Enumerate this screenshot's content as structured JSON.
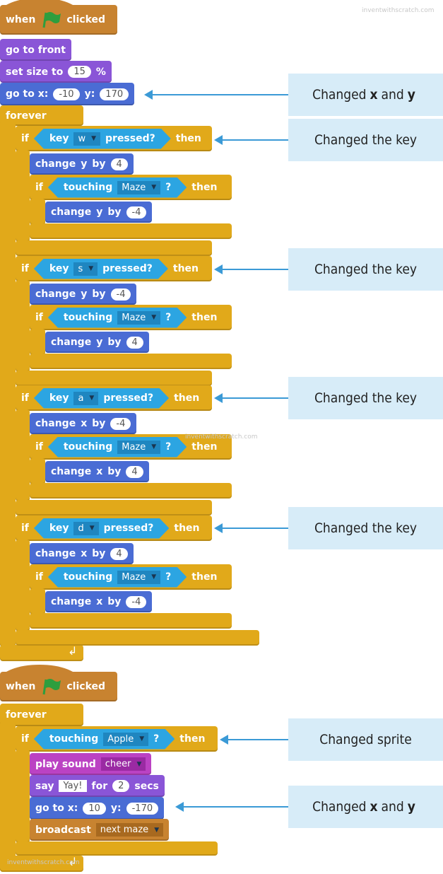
{
  "colors": {
    "events": "#c88330",
    "looks": "#8a55d7",
    "motion": "#4a6cd4",
    "control": "#e1a91a",
    "sensing": "#2ca5e2",
    "sensing_dropdown": "#1f86c0",
    "sound": "#bb42c3",
    "sound_dropdown": "#9a2aa3",
    "events_dropdown": "#a8691f",
    "callout": "#d7ecf8",
    "arrow": "#3b9ad6",
    "flag": "#2e9e3e"
  },
  "watermark": "inventwithscratch.com",
  "script1": {
    "hat": {
      "when": "when",
      "clicked": "clicked",
      "icon": "green-flag-icon"
    },
    "go_to_front": "go to front",
    "set_size": {
      "label": "set size to",
      "value": "15",
      "unit": "%"
    },
    "go_to": {
      "x_label": "go to x:",
      "x": "-10",
      "y_label": "y:",
      "y": "170"
    },
    "forever": "forever",
    "ifs": [
      {
        "if": "if",
        "key": "key",
        "key_value": "w",
        "pressed": "pressed?",
        "then": "then",
        "change1": {
          "label1": "change",
          "axis": "y",
          "by": "by",
          "value": "4"
        },
        "touching": {
          "label": "touching",
          "target": "Maze",
          "q": "?",
          "then": "then",
          "if": "if"
        },
        "change2": {
          "label1": "change",
          "axis": "y",
          "by": "by",
          "value": "-4"
        }
      },
      {
        "if": "if",
        "key": "key",
        "key_value": "s",
        "pressed": "pressed?",
        "then": "then",
        "change1": {
          "label1": "change",
          "axis": "y",
          "by": "by",
          "value": "-4"
        },
        "touching": {
          "label": "touching",
          "target": "Maze",
          "q": "?",
          "then": "then",
          "if": "if"
        },
        "change2": {
          "label1": "change",
          "axis": "y",
          "by": "by",
          "value": "4"
        }
      },
      {
        "if": "if",
        "key": "key",
        "key_value": "a",
        "pressed": "pressed?",
        "then": "then",
        "change1": {
          "label1": "change",
          "axis": "x",
          "by": "by",
          "value": "-4"
        },
        "touching": {
          "label": "touching",
          "target": "Maze",
          "q": "?",
          "then": "then",
          "if": "if"
        },
        "change2": {
          "label1": "change",
          "axis": "x",
          "by": "by",
          "value": "4"
        }
      },
      {
        "if": "if",
        "key": "key",
        "key_value": "d",
        "pressed": "pressed?",
        "then": "then",
        "change1": {
          "label1": "change",
          "axis": "x",
          "by": "by",
          "value": "4"
        },
        "touching": {
          "label": "touching",
          "target": "Maze",
          "q": "?",
          "then": "then",
          "if": "if"
        },
        "change2": {
          "label1": "change",
          "axis": "x",
          "by": "by",
          "value": "-4"
        }
      }
    ]
  },
  "script2": {
    "hat": {
      "when": "when",
      "clicked": "clicked",
      "icon": "green-flag-icon"
    },
    "forever": "forever",
    "if": {
      "if": "if",
      "label": "touching",
      "target": "Apple",
      "q": "?",
      "then": "then"
    },
    "play_sound": {
      "label": "play sound",
      "value": "cheer"
    },
    "say": {
      "label": "say",
      "text": "Yay!",
      "for": "for",
      "secs_value": "2",
      "secs": "secs"
    },
    "go_to": {
      "x_label": "go to x:",
      "x": "10",
      "y_label": "y:",
      "y": "-170"
    },
    "broadcast": {
      "label": "broadcast",
      "value": "next maze"
    }
  },
  "callouts": [
    {
      "pre": "Changed",
      "b1": "x",
      "mid": "and",
      "b2": "y"
    },
    {
      "pre": "Changed the key",
      "b1": "",
      "mid": "",
      "b2": ""
    },
    {
      "pre": "Changed the key",
      "b1": "",
      "mid": "",
      "b2": ""
    },
    {
      "pre": "Changed the key",
      "b1": "",
      "mid": "",
      "b2": ""
    },
    {
      "pre": "Changed the key",
      "b1": "",
      "mid": "",
      "b2": ""
    },
    {
      "pre": "Changed sprite",
      "b1": "",
      "mid": "",
      "b2": ""
    },
    {
      "pre": "Changed",
      "b1": "x",
      "mid": "and",
      "b2": "y"
    }
  ]
}
